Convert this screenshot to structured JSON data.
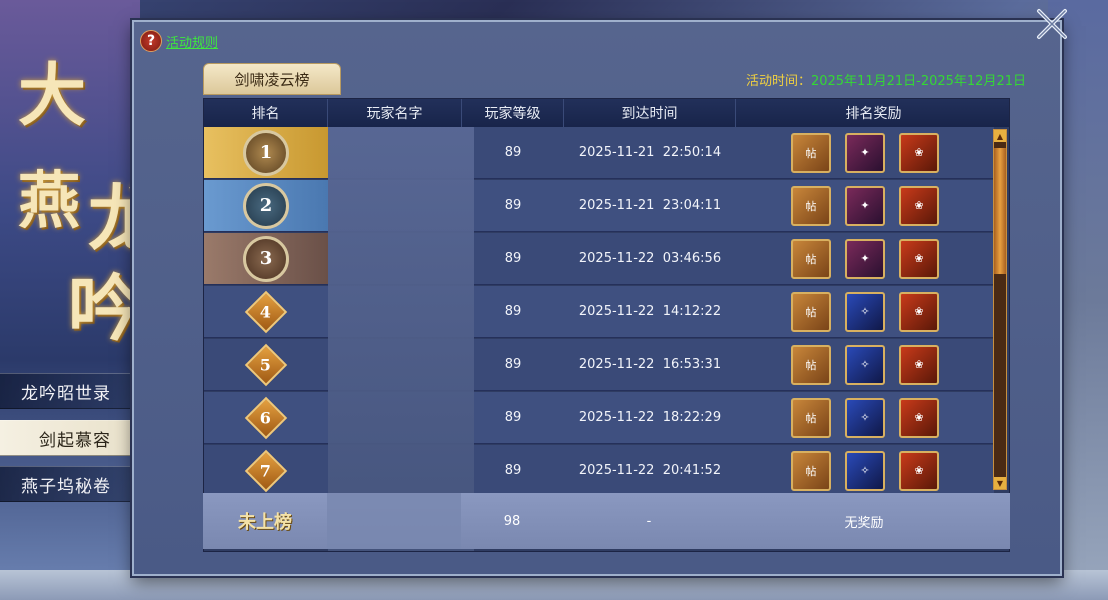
{
  "sidebar": {
    "title_chars": [
      "大",
      "燕",
      "龙",
      "吟"
    ],
    "items": [
      {
        "label": "龙吟昭世录",
        "active": false
      },
      {
        "label": "剑起慕容",
        "active": true
      },
      {
        "label": "燕子坞秘卷",
        "active": false
      }
    ]
  },
  "header": {
    "help_label": "活动规则",
    "tab_label": "剑啸凌云榜",
    "time_label": "活动时间：",
    "time_value": "2025年11月21日-2025年12月21日"
  },
  "table": {
    "columns": [
      "排名",
      "玩家名字",
      "玩家等级",
      "到达时间",
      "排名奖励"
    ],
    "rows": [
      {
        "rank": "1",
        "level": "89",
        "time": "2025-11-21  22:50:14",
        "rewards": [
          "book-icon",
          "wing-icon",
          "gift-icon"
        ]
      },
      {
        "rank": "2",
        "level": "89",
        "time": "2025-11-21  23:04:11",
        "rewards": [
          "book-icon",
          "wing-icon",
          "gift-icon"
        ]
      },
      {
        "rank": "3",
        "level": "89",
        "time": "2025-11-22  03:46:56",
        "rewards": [
          "book-icon",
          "wing-icon",
          "gift-icon"
        ]
      },
      {
        "rank": "4",
        "level": "89",
        "time": "2025-11-22  14:12:22",
        "rewards": [
          "book-icon",
          "feather-icon",
          "gift-icon"
        ]
      },
      {
        "rank": "5",
        "level": "89",
        "time": "2025-11-22  16:53:31",
        "rewards": [
          "book-icon",
          "feather-icon",
          "gift-icon"
        ]
      },
      {
        "rank": "6",
        "level": "89",
        "time": "2025-11-22  18:22:29",
        "rewards": [
          "book-icon",
          "feather-icon",
          "gift-icon"
        ]
      },
      {
        "rank": "7",
        "level": "89",
        "time": "2025-11-22  20:41:52",
        "rewards": [
          "book-icon",
          "feather-icon",
          "gift-icon"
        ]
      }
    ],
    "self_row": {
      "rank_label": "未上榜",
      "level": "98",
      "time": "-",
      "reward": "无奖励"
    }
  },
  "colors": {
    "gold": "#e8b040",
    "silver": "#5a8ac0",
    "bronze": "#8a6a5a",
    "time_value": "#34d834",
    "time_label": "#f0d040"
  }
}
